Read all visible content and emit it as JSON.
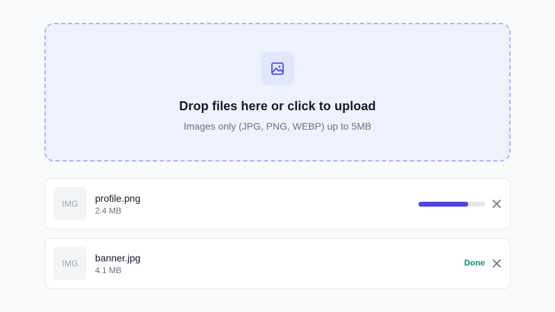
{
  "dropzone": {
    "title": "Drop files here or click to upload",
    "subtitle": "Images only (JPG, PNG, WEBP) up to 5MB",
    "icon": "image-icon"
  },
  "files": [
    {
      "thumb_label": "IMG",
      "name": "profile.png",
      "size": "2.4 MB",
      "progress": 0.75,
      "status": "uploading"
    },
    {
      "thumb_label": "IMG",
      "name": "banner.jpg",
      "size": "4.1 MB",
      "status_label": "Done",
      "status": "done"
    }
  ],
  "colors": {
    "accent": "#4f46e5",
    "success": "#059669",
    "dropzone_bg": "#eef2ff",
    "dropzone_border": "#a5b4fc"
  }
}
